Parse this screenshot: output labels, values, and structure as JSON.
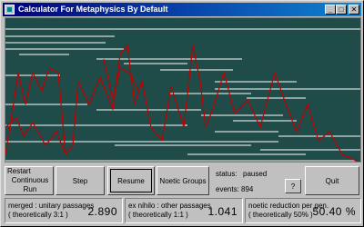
{
  "window": {
    "title": "Calculator For Metaphysics By Default",
    "minimize_glyph": "_",
    "maximize_glyph": "□",
    "close_glyph": "✕"
  },
  "plot": {
    "background": "#1f4b48",
    "line_color": "#ffffff",
    "trace_color": "#c00000"
  },
  "controls": {
    "restart_line1": "Restart",
    "restart_line2": "Continuous Run",
    "step_label": "Step",
    "resume_label": "Resume",
    "noetic_groups_label": "Noetic Groups",
    "status_label": "status:",
    "status_value": "paused",
    "events_label": "events:",
    "events_value": "894",
    "help_label": "?",
    "quit_label": "Quit"
  },
  "stats": {
    "merged": {
      "line1": "merged : unitary passages",
      "line2": "( theoretically 3:1 )",
      "value": "2.890"
    },
    "ex_nihilo": {
      "line1": "ex nihilo : other passages",
      "line2": "( theoretically 1:1 )",
      "value": "1.041"
    },
    "noetic": {
      "line1": "noetic reduction per gen.",
      "line2": "( theoretically 50% )",
      "value": "50.40 %"
    }
  }
}
